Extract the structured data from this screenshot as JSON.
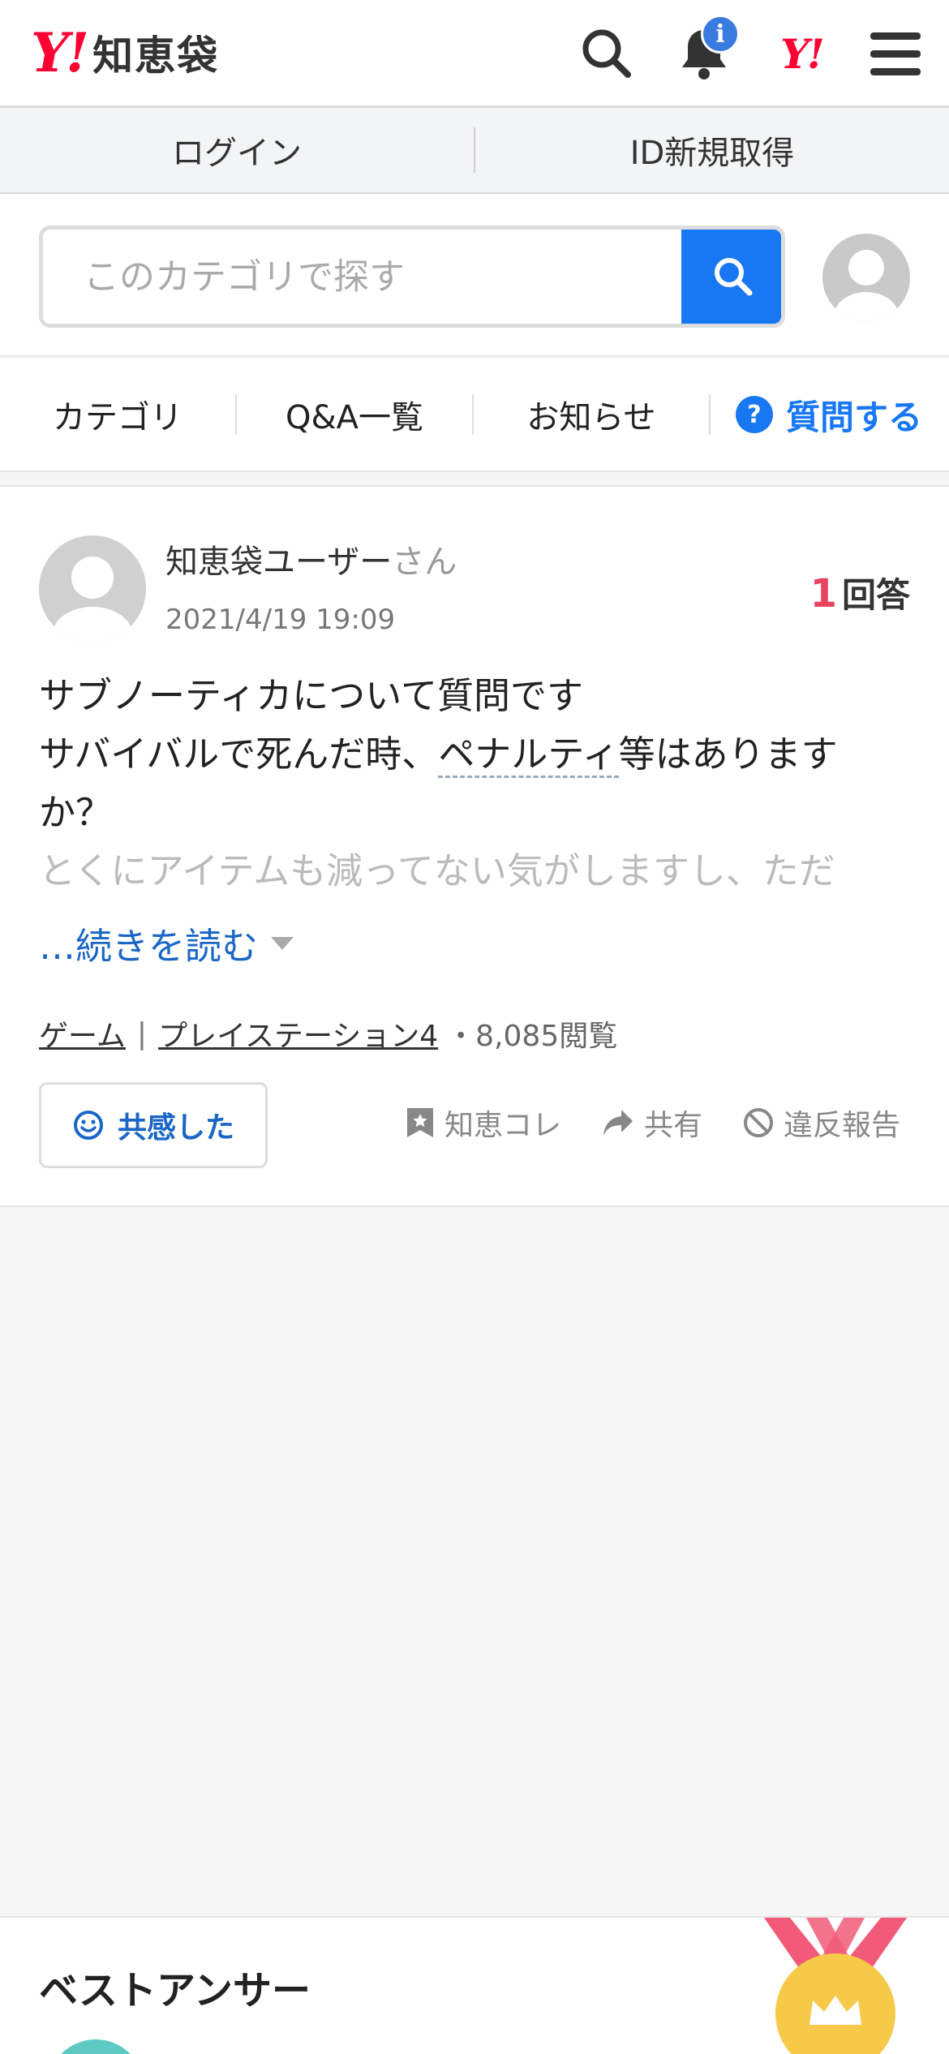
{
  "header": {
    "logo_y": "Y!",
    "logo_text": "知恵袋",
    "notification_badge": "i",
    "yahoo_small": "Y!"
  },
  "login_bar": {
    "login_label": "ログイン",
    "register_label": "ID新規取得"
  },
  "search": {
    "placeholder": "このカテゴリで探す"
  },
  "nav": {
    "category": "カテゴリ",
    "qa_list": "Q&A一覧",
    "news": "お知らせ",
    "ask_icon": "?",
    "ask": "質問する"
  },
  "question": {
    "user_name": "知恵袋ユーザー",
    "user_suffix": "さん",
    "date": "2021/4/19 19:09",
    "answer_count": "1",
    "answer_label": "回答",
    "body_line1": "サブノーティカについて質問です",
    "body_line2_pre": "サバイバルで死んだ時、",
    "body_line2_link": "ペナルティ",
    "body_line2_post": "等はあります",
    "body_line3": "か？",
    "body_fade": "とくにアイテムも減ってない気がしますし、ただ",
    "read_more": "…続きを読む",
    "category1": "ゲーム",
    "category_sep": "|",
    "category2": "プレイステーション4",
    "views": "・8,085閲覧",
    "empathy": "共感した",
    "save": "知恵コレ",
    "share": "共有",
    "report": "違反報告"
  },
  "best_answer": {
    "title": "ベストアンサー"
  },
  "colors": {
    "brand_red": "#ff0033",
    "primary_blue": "#1877f2",
    "answer_count_red": "#e8435f",
    "link_blue": "#1a66c7"
  }
}
